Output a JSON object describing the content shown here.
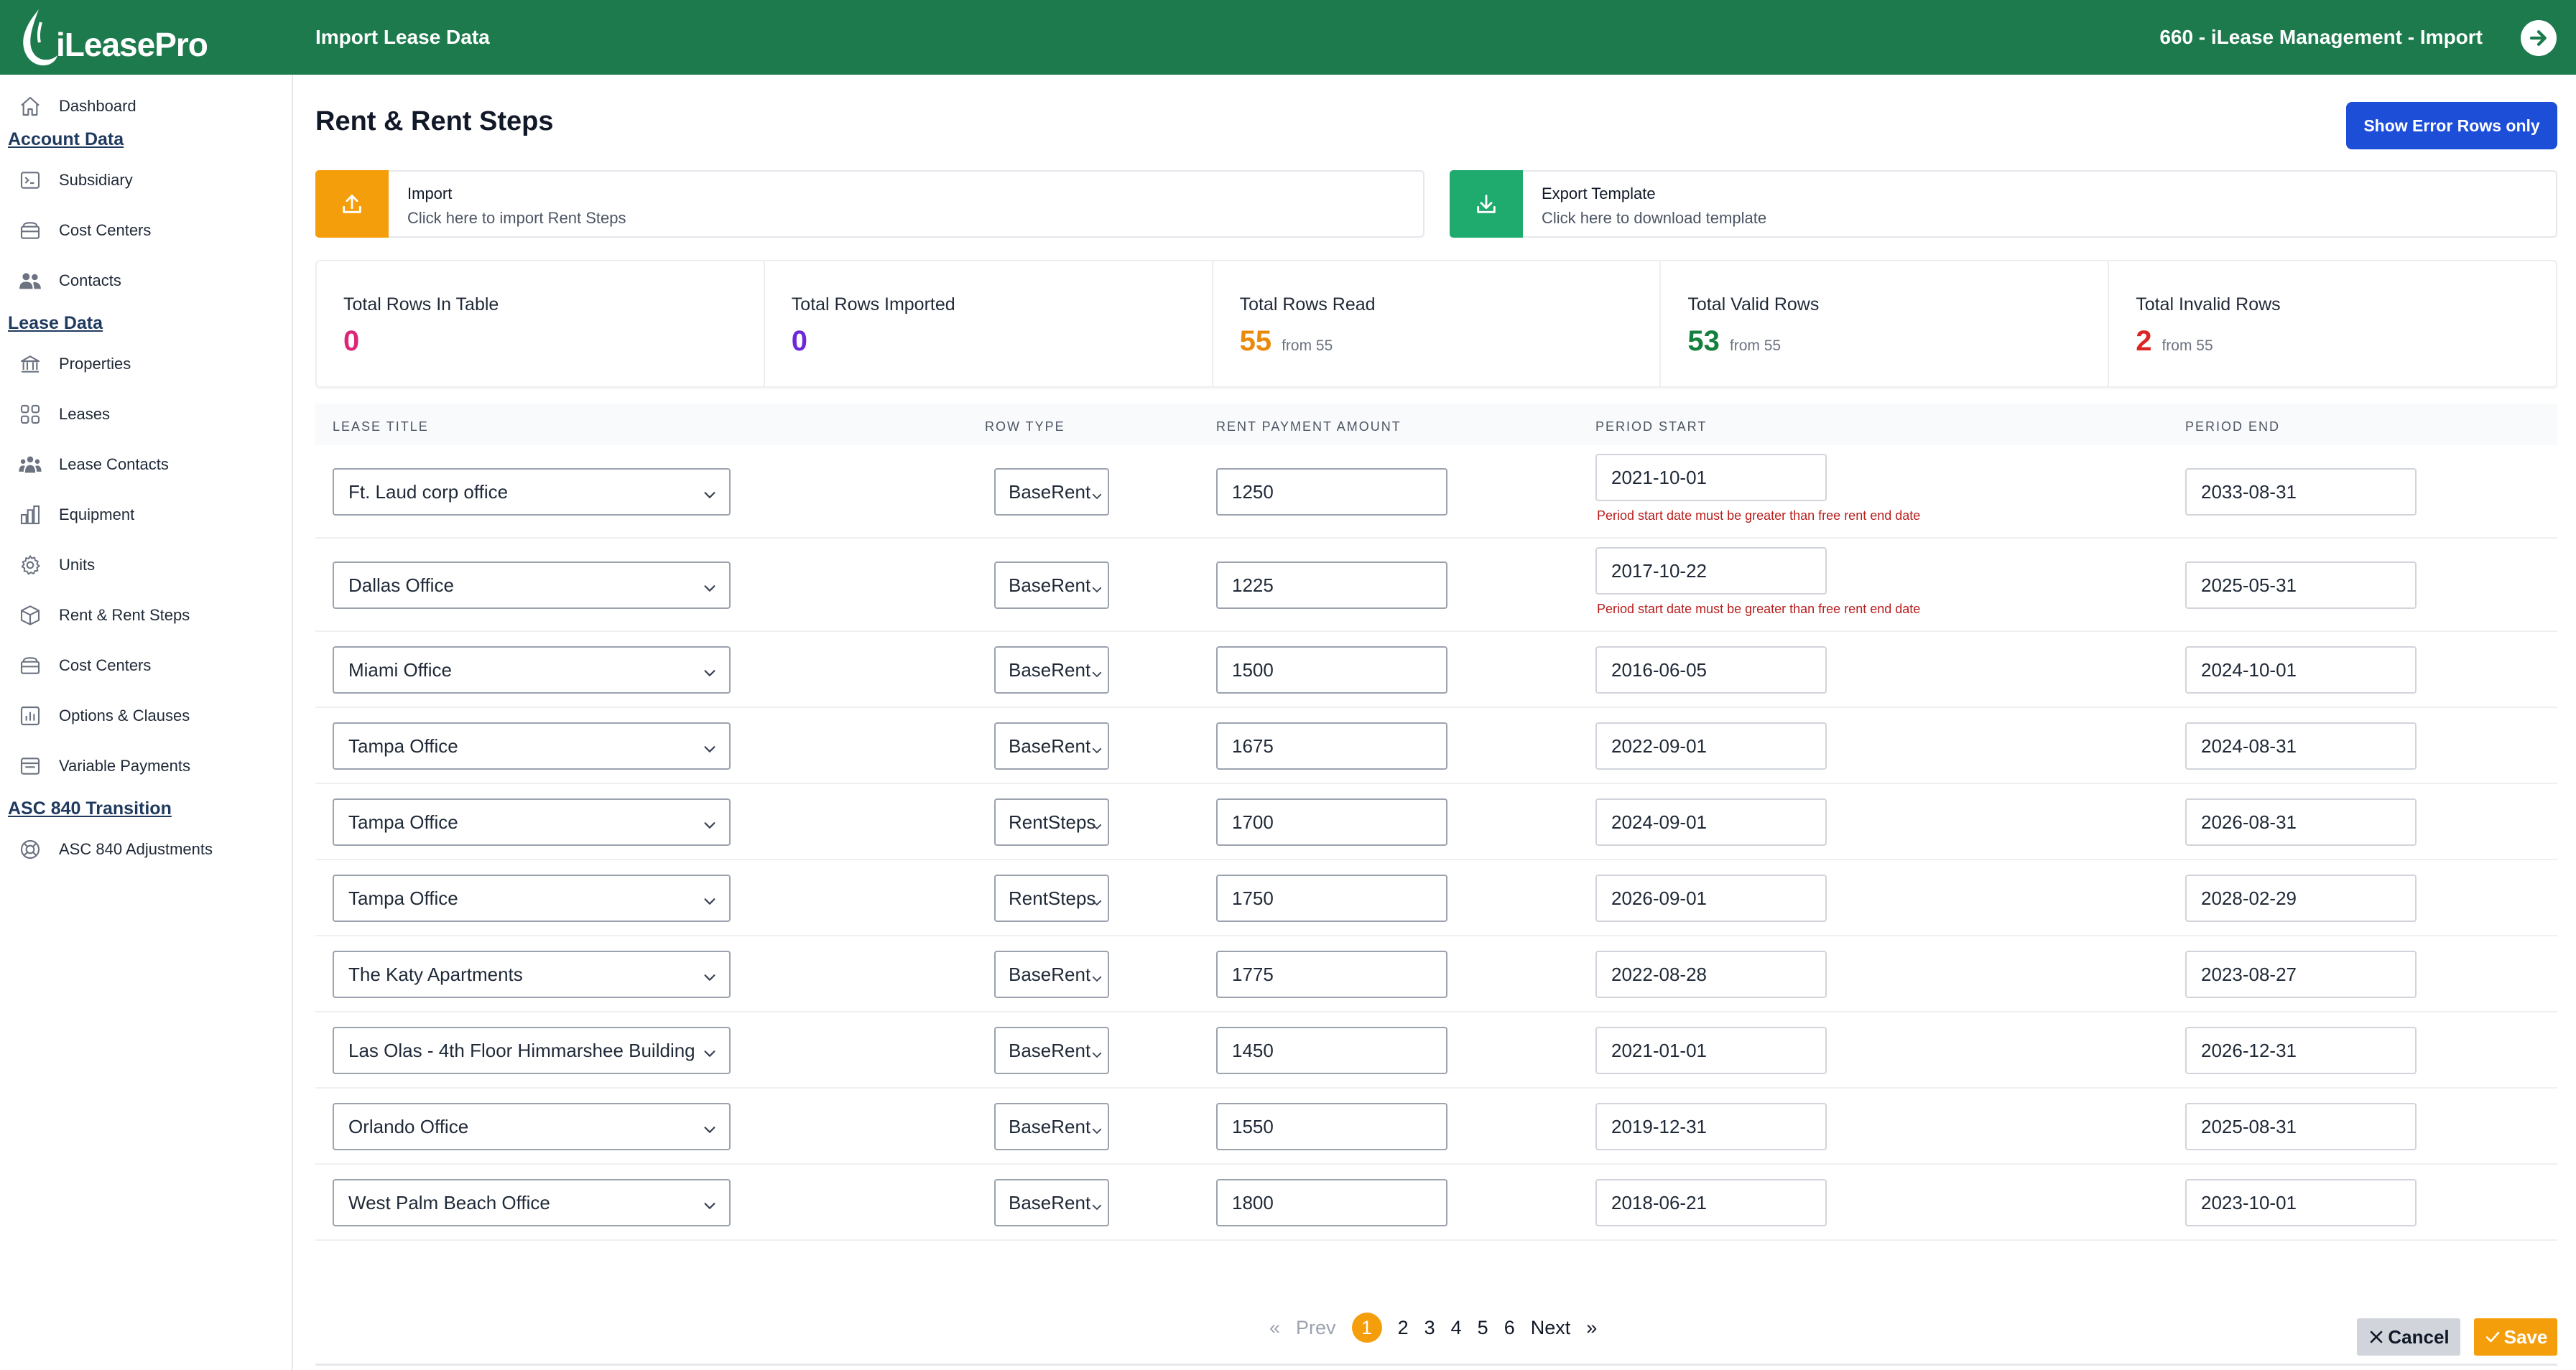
{
  "header": {
    "logo_text": "iLeasePro",
    "page_title": "Import Lease Data",
    "org_title": "660 - iLease Management - Import"
  },
  "sidebar": {
    "dashboard": "Dashboard",
    "sections": {
      "account": "Account Data",
      "lease": "Lease Data",
      "asc": "ASC 840 Transition"
    },
    "items": [
      {
        "label": "Subsidiary",
        "icon": "terminal-icon"
      },
      {
        "label": "Cost Centers",
        "icon": "archive-icon"
      },
      {
        "label": "Contacts",
        "icon": "users-icon"
      },
      {
        "label": "Properties",
        "icon": "bank-icon"
      },
      {
        "label": "Leases",
        "icon": "grid-icon"
      },
      {
        "label": "Lease Contacts",
        "icon": "users-icon"
      },
      {
        "label": "Equipment",
        "icon": "bar-chart-icon"
      },
      {
        "label": "Units",
        "icon": "gear-icon"
      },
      {
        "label": "Rent & Rent Steps",
        "icon": "cube-icon"
      },
      {
        "label": "Cost Centers",
        "icon": "archive-icon"
      },
      {
        "label": "Options & Clauses",
        "icon": "chart-icon"
      },
      {
        "label": "Variable Payments",
        "icon": "inbox-icon"
      },
      {
        "label": "ASC 840 Adjustments",
        "icon": "lifebuoy-icon"
      }
    ]
  },
  "main": {
    "title": "Rent & Rent Steps",
    "show_error_rows": "Show Error Rows only",
    "import_card": {
      "title": "Import",
      "subtitle": "Click here to import Rent Steps",
      "color": "#f59e0b"
    },
    "export_card": {
      "title": "Export Template",
      "subtitle": "Click here to download template",
      "color": "#1faa6e"
    },
    "stats": [
      {
        "label": "Total Rows In Table",
        "value": "0",
        "from": "",
        "color": "#db2777"
      },
      {
        "label": "Total Rows Imported",
        "value": "0",
        "from": "",
        "color": "#6d28d9"
      },
      {
        "label": "Total Rows Read",
        "value": "55",
        "from": "from 55",
        "color": "#ea8a0c"
      },
      {
        "label": "Total Valid Rows",
        "value": "53",
        "from": "from 55",
        "color": "#15803d"
      },
      {
        "label": "Total Invalid Rows",
        "value": "2",
        "from": "from 55",
        "color": "#dc2626"
      }
    ],
    "columns": {
      "lease_title": "LEASE TITLE",
      "row_type": "ROW TYPE",
      "amount": "RENT PAYMENT AMOUNT",
      "period_start": "PERIOD START",
      "period_end": "PERIOD END"
    },
    "rows": [
      {
        "lease": "Ft. Laud corp office",
        "type": "BaseRent",
        "amount": "1250",
        "start": "2021-10-01",
        "end": "2033-08-31",
        "error": "Period start date must be greater than free rent end date"
      },
      {
        "lease": "Dallas Office",
        "type": "BaseRent",
        "amount": "1225",
        "start": "2017-10-22",
        "end": "2025-05-31",
        "error": "Period start date must be greater than free rent end date"
      },
      {
        "lease": "Miami Office",
        "type": "BaseRent",
        "amount": "1500",
        "start": "2016-06-05",
        "end": "2024-10-01",
        "error": ""
      },
      {
        "lease": "Tampa Office",
        "type": "BaseRent",
        "amount": "1675",
        "start": "2022-09-01",
        "end": "2024-08-31",
        "error": ""
      },
      {
        "lease": "Tampa Office",
        "type": "RentSteps",
        "amount": "1700",
        "start": "2024-09-01",
        "end": "2026-08-31",
        "error": ""
      },
      {
        "lease": "Tampa Office",
        "type": "RentSteps",
        "amount": "1750",
        "start": "2026-09-01",
        "end": "2028-02-29",
        "error": ""
      },
      {
        "lease": "The Katy Apartments",
        "type": "BaseRent",
        "amount": "1775",
        "start": "2022-08-28",
        "end": "2023-08-27",
        "error": ""
      },
      {
        "lease": "Las Olas - 4th Floor Himmarshee Building",
        "type": "BaseRent",
        "amount": "1450",
        "start": "2021-01-01",
        "end": "2026-12-31",
        "error": ""
      },
      {
        "lease": "Orlando Office",
        "type": "BaseRent",
        "amount": "1550",
        "start": "2019-12-31",
        "end": "2025-08-31",
        "error": ""
      },
      {
        "lease": "West Palm Beach Office",
        "type": "BaseRent",
        "amount": "1800",
        "start": "2018-06-21",
        "end": "2023-10-01",
        "error": ""
      }
    ],
    "pagination": {
      "first": "«",
      "prev": "Prev",
      "current": "1",
      "pages": [
        "2",
        "3",
        "4",
        "5",
        "6"
      ],
      "next": "Next",
      "last": "»"
    },
    "cancel": "Cancel",
    "save": "Save"
  }
}
